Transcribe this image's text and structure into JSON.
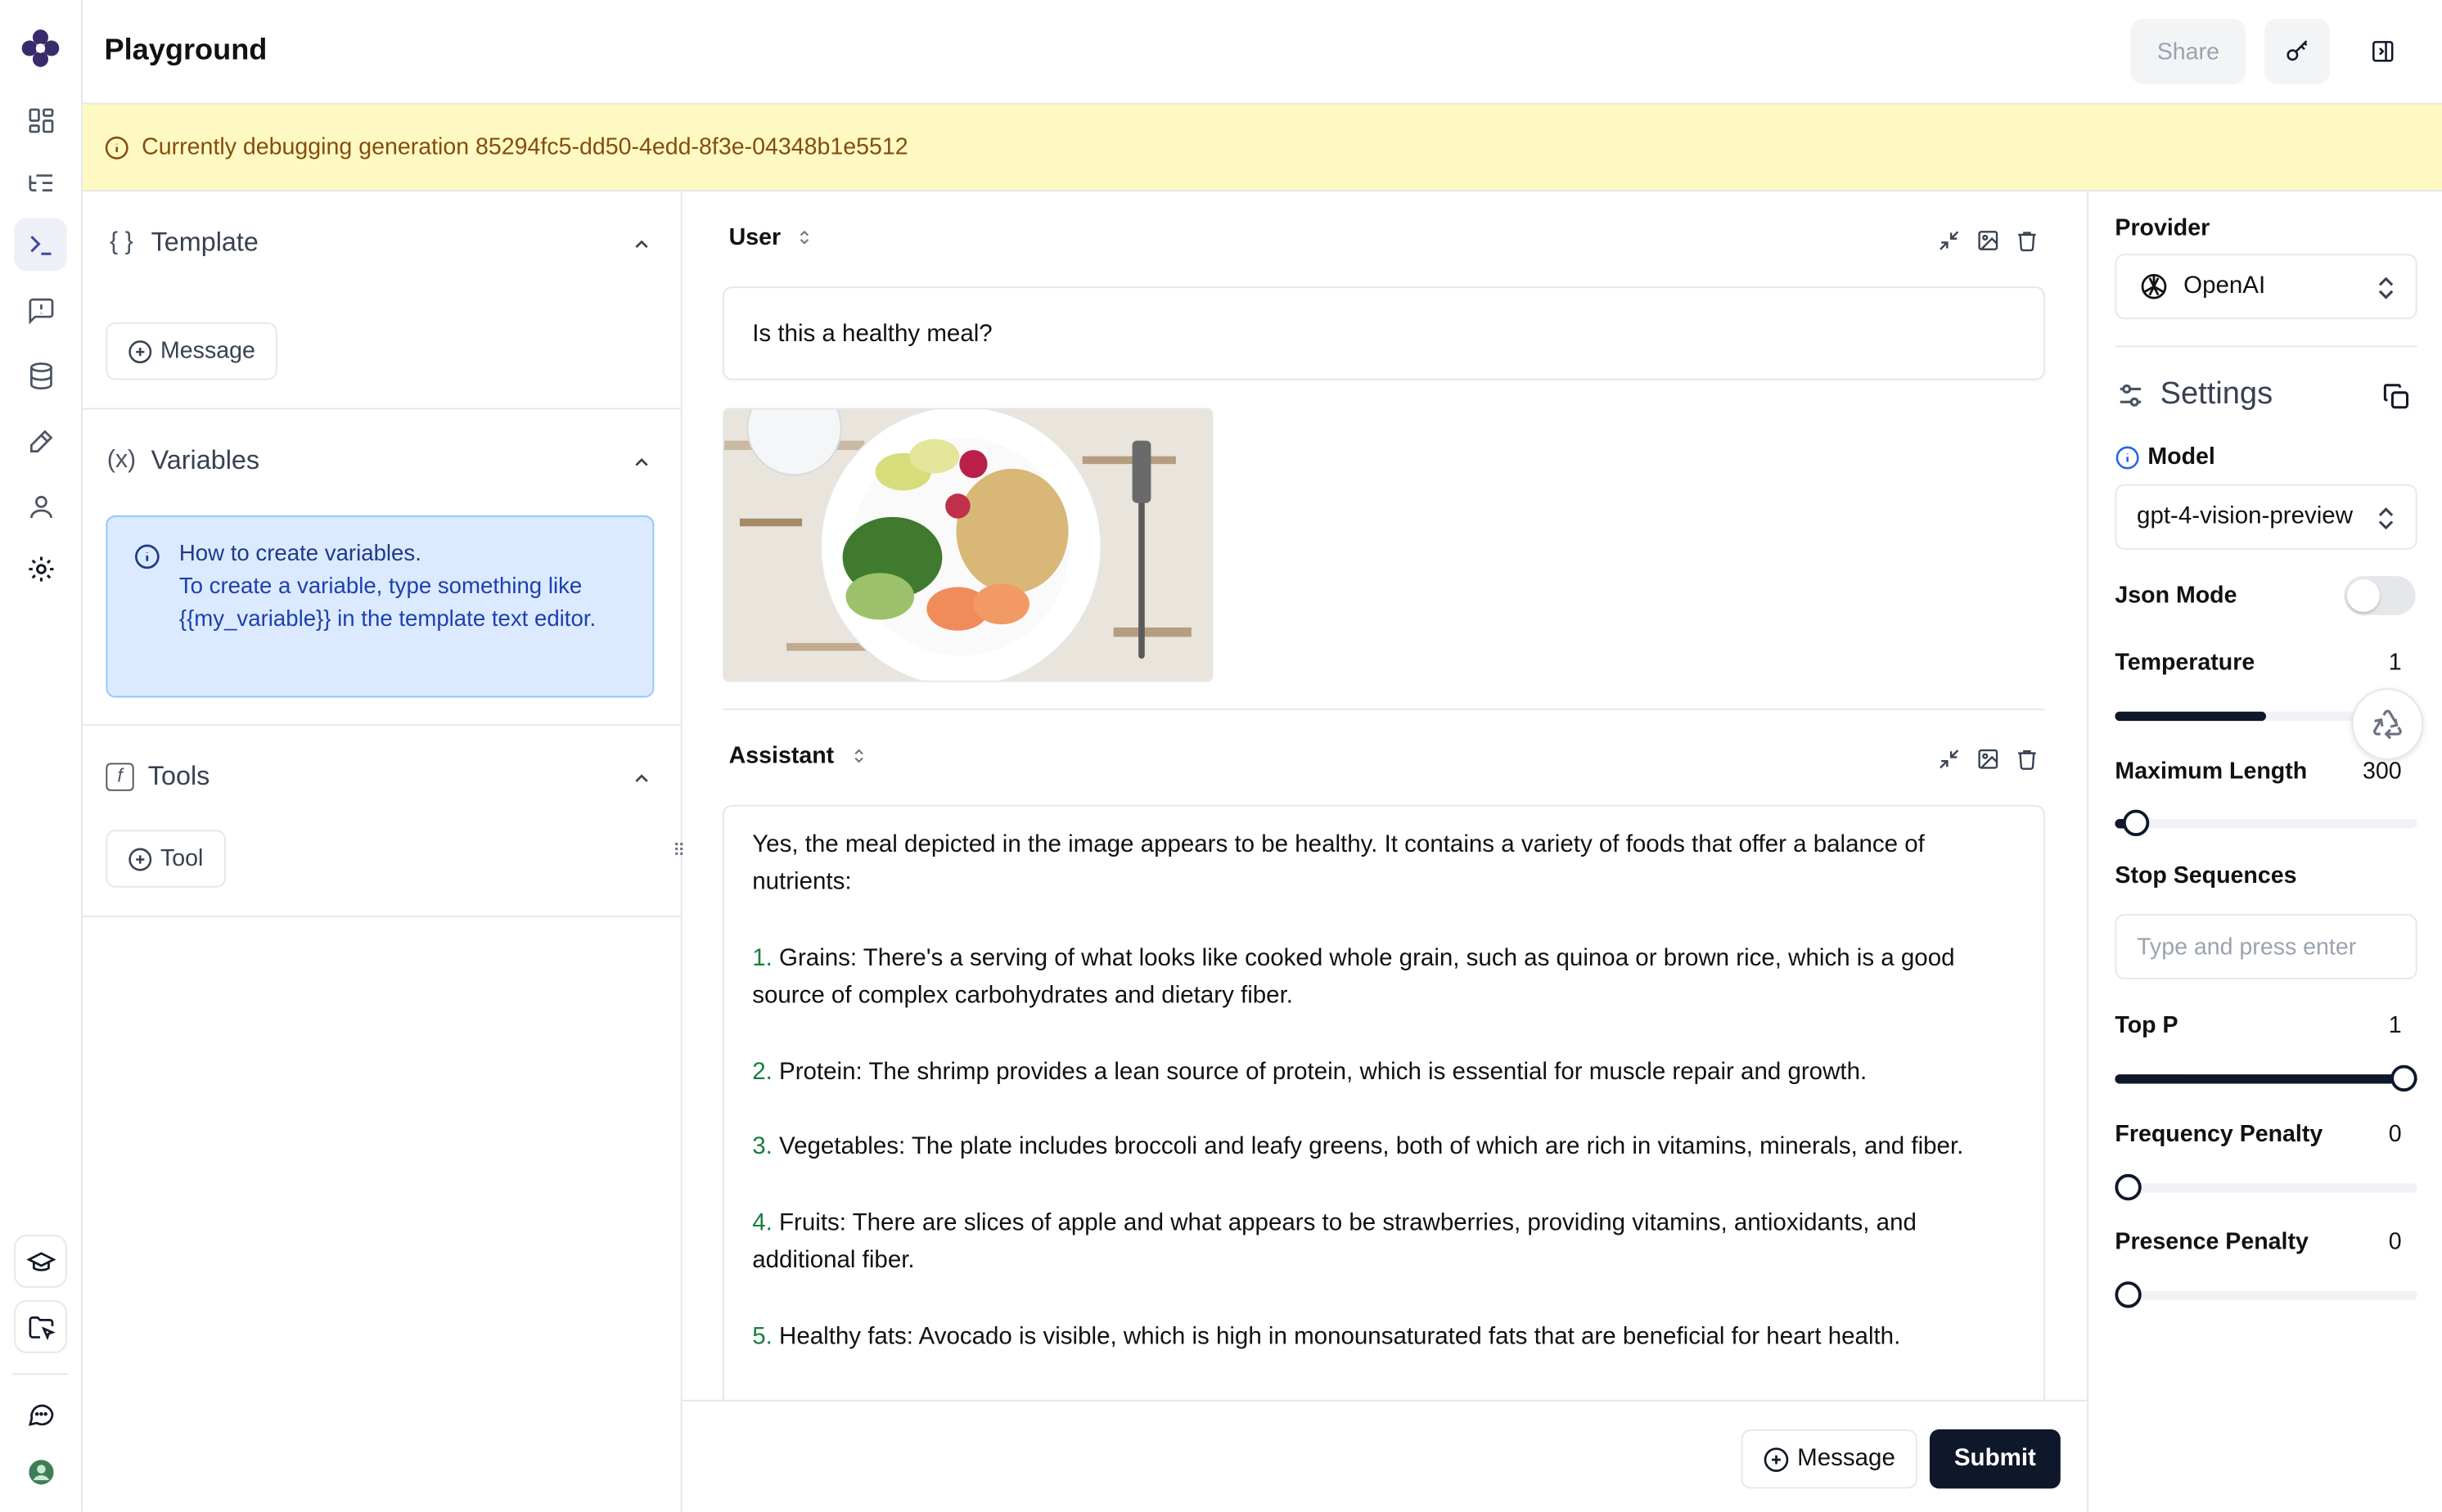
{
  "header": {
    "title": "Playground",
    "share_label": "Share"
  },
  "banner": {
    "text": "Currently debugging generation 85294fc5-dd50-4edd-8f3e-04348b1e5512"
  },
  "template_panel": {
    "template": {
      "title": "Template",
      "add_message_label": "Message"
    },
    "variables": {
      "title": "Variables",
      "info_title": "How to create variables.",
      "info_body": "To create a variable, type something like {{my_variable}} in the template text editor."
    },
    "tools": {
      "title": "Tools",
      "add_tool_label": "Tool"
    }
  },
  "chat": {
    "user": {
      "role": "User",
      "text": "Is this a healthy meal?"
    },
    "assistant": {
      "role": "Assistant",
      "intro": "Yes, the meal depicted in the image appears to be healthy. It contains a variety of foods that offer a balance of nutrients:",
      "items": [
        {
          "num": "1.",
          "text": "Grains: There's a serving of what looks like cooked whole grain, such as quinoa or brown rice, which is a good source of complex carbohydrates and dietary fiber."
        },
        {
          "num": "2.",
          "text": "Protein: The shrimp provides a lean source of protein, which is essential for muscle repair and growth."
        },
        {
          "num": "3.",
          "text": "Vegetables: The plate includes broccoli and leafy greens, both of which are rich in vitamins, minerals, and fiber."
        },
        {
          "num": "4.",
          "text": "Fruits: There are slices of apple and what appears to be strawberries, providing vitamins, antioxidants, and additional fiber."
        },
        {
          "num": "5.",
          "text": "Healthy fats: Avocado is visible, which is high in monounsaturated fats that are beneficial for heart health."
        }
      ]
    },
    "add_message_label": "Message",
    "submit_label": "Submit"
  },
  "settings": {
    "provider_label": "Provider",
    "provider_value": "OpenAI",
    "settings_title": "Settings",
    "model_label": "Model",
    "model_value": "gpt-4-vision-preview",
    "json_mode_label": "Json Mode",
    "json_mode_on": false,
    "temperature": {
      "label": "Temperature",
      "value": "1",
      "fraction": 0.5
    },
    "max_length": {
      "label": "Maximum Length",
      "value": "300",
      "fraction": 0.07
    },
    "stop_sequences": {
      "label": "Stop Sequences",
      "placeholder": "Type and press enter"
    },
    "top_p": {
      "label": "Top P",
      "value": "1",
      "fraction": 1.0
    },
    "frequency_penalty": {
      "label": "Frequency Penalty",
      "value": "0",
      "fraction": 0.0
    },
    "presence_penalty": {
      "label": "Presence Penalty",
      "value": "0",
      "fraction": 0.0
    }
  },
  "colors": {
    "accent": "#0f172a",
    "banner_bg": "#fef9c3",
    "info_bg": "#dbeafe",
    "list_number": "#16803c"
  }
}
